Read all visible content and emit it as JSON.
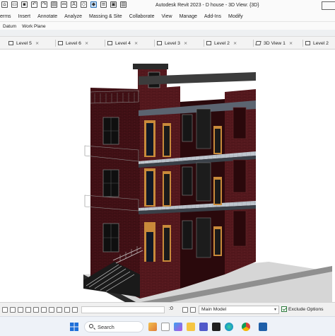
{
  "window": {
    "title": "Autodesk Revit 2023 - D house - 3D View: {3D}"
  },
  "menu": {
    "items": [
      "erms",
      "Insert",
      "Annotate",
      "Analyze",
      "Massing & Site",
      "Collaborate",
      "View",
      "Manage",
      "Add-Ins",
      "Modify"
    ]
  },
  "options_bar": {
    "items": [
      "Datum",
      "Work Plane"
    ]
  },
  "view_tabs": [
    {
      "label": "Level 5",
      "icon": "floor-plan-icon"
    },
    {
      "label": "Level 6",
      "icon": "floor-plan-icon"
    },
    {
      "label": "Level 4",
      "icon": "floor-plan-icon"
    },
    {
      "label": "Level 3",
      "icon": "floor-plan-icon"
    },
    {
      "label": "Level 2",
      "icon": "floor-plan-icon"
    },
    {
      "label": "3D View 1",
      "icon": "3d-view-icon"
    },
    {
      "label": "Level 2",
      "icon": "floor-plan-icon"
    }
  ],
  "view_controls": {
    "zero_value": ":0",
    "model_selector": "Main Model",
    "exclude_options_label": "Exclude Options",
    "exclude_options_checked": true
  },
  "taskbar": {
    "search_label": "Search",
    "apps": [
      "windows-start-icon",
      "search-icon",
      "widgets-icon",
      "file-explorer-icon",
      "copilot-icon",
      "teams-icon",
      "store-icon",
      "edge-icon",
      "chrome-icon",
      "revit-icon"
    ]
  },
  "colors": {
    "brick": "#4a1419",
    "window_trim": "#c98a3a",
    "accent": "#2a6fb3"
  }
}
